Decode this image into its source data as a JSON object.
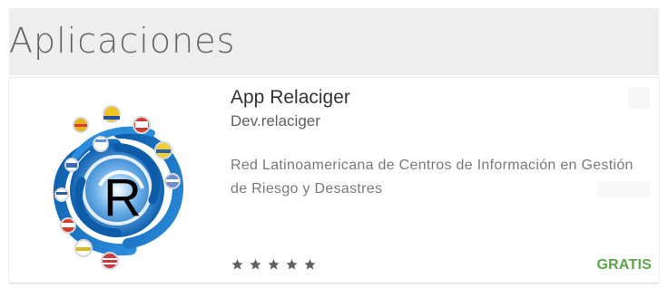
{
  "section": {
    "title": "Aplicaciones"
  },
  "app": {
    "title": "App Relaciger",
    "developer": "Dev.relaciger",
    "description": "Red Latinoamericana de Centros de Información en Gestión de Riesgo y Desastres",
    "icon_name": "relaciger-app-icon",
    "icon_letter": "R",
    "rating": {
      "stars": 5,
      "icon_name": "star-icon"
    },
    "price": "GRATIS",
    "colors": {
      "price": "#5ea44a",
      "title": "#333333",
      "muted": "#7a7a7a",
      "header_bg": "#eeeeee",
      "icon_blue": "#1f6fb8"
    }
  }
}
